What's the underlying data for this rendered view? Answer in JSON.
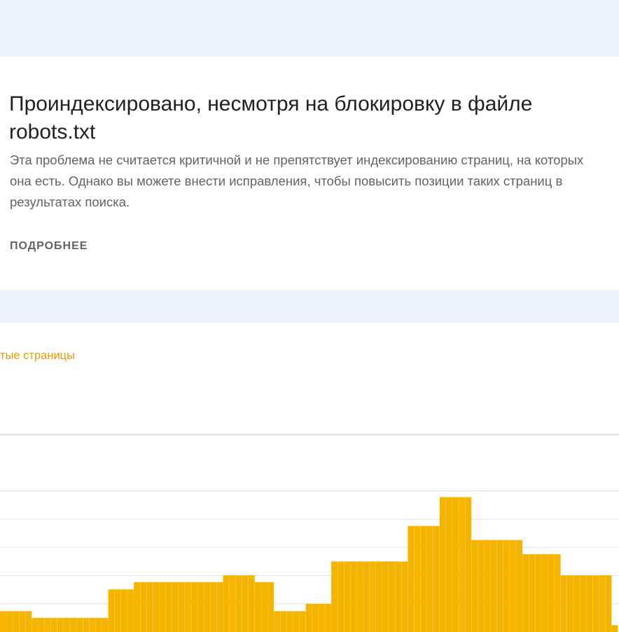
{
  "issue": {
    "title": "Проиндексировано, несмотря на блокировку в файле robots.txt",
    "description": "Эта проблема не считается критичной и не препятствует индексированию страниц, на которых она есть. Однако вы можете внести исправления, чтобы повысить позиции таких страниц в результатах поиска.",
    "more_label": "ПОДРОБНЕЕ"
  },
  "chart": {
    "legend_label": "тые страницы",
    "bar_color": "#f4b400",
    "grid_color": "#e0e0e0"
  },
  "chart_data": {
    "type": "bar",
    "title": "",
    "xlabel": "",
    "ylabel": "",
    "grid": true,
    "ylim": [
      0,
      7
    ],
    "gridlines": [
      1,
      2,
      3,
      4,
      5,
      7
    ],
    "values": [
      0.74,
      0.74,
      0.74,
      0.74,
      0.74,
      0.5,
      0.5,
      0.5,
      0.5,
      0.5,
      0.5,
      0.5,
      0.5,
      0.5,
      0.5,
      0.5,
      0.5,
      1.51,
      1.51,
      1.51,
      1.51,
      1.77,
      1.77,
      1.77,
      1.77,
      1.77,
      1.77,
      1.77,
      1.77,
      1.77,
      1.77,
      1.77,
      1.77,
      1.77,
      1.77,
      2.01,
      2.01,
      2.01,
      2.01,
      2.01,
      1.77,
      1.77,
      1.77,
      0.74,
      0.74,
      0.74,
      0.74,
      0.74,
      1.0,
      1.0,
      1.0,
      1.0,
      2.5,
      2.5,
      2.5,
      2.5,
      2.5,
      2.5,
      2.5,
      2.5,
      2.5,
      2.5,
      2.5,
      2.5,
      3.76,
      3.76,
      3.76,
      3.76,
      3.76,
      4.78,
      4.78,
      4.78,
      4.78,
      4.78,
      3.26,
      3.26,
      3.26,
      3.26,
      3.26,
      3.26,
      3.26,
      3.26,
      2.76,
      2.76,
      2.76,
      2.76,
      2.76,
      2.76,
      2.01,
      2.01,
      2.01,
      2.01,
      2.01,
      2.01,
      2.01,
      2.01,
      0.24
    ]
  }
}
